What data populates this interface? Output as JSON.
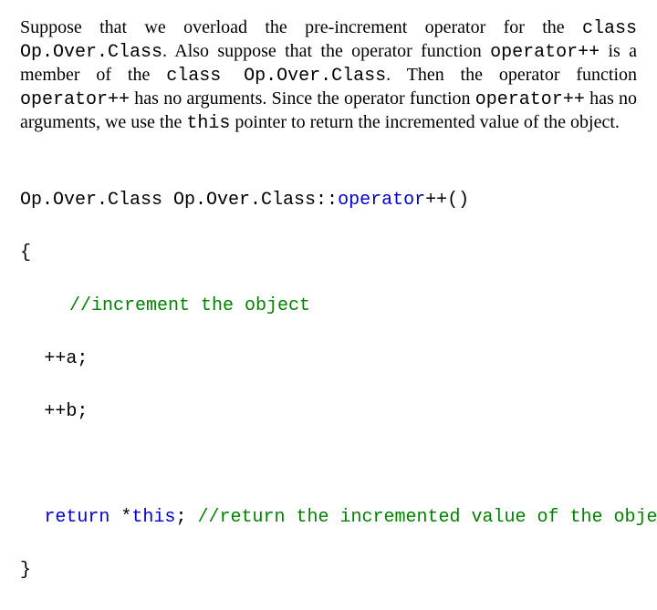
{
  "para": {
    "t1": "Suppose that we overload the pre-increment operator for the ",
    "c1": "class Op.Over.Class",
    "t2": ". Also suppose that the operator function ",
    "c2": "operator++",
    "t3": " is a member of the ",
    "c3": "class Op.Over.Class",
    "t4": ". Then the operator function ",
    "c4": "operator++",
    "t5": " has no arguments. Since the operator function ",
    "c5": "operator++",
    "t6": " has no arguments, we use the ",
    "c6": "this",
    "t7": " pointer to return the incremented value of the object."
  },
  "code": {
    "l1a": "Op.Over.Class Op.Over.Class::",
    "l1b": "operator",
    "l1c": "++()",
    "l2": "{",
    "l3": "//increment the object",
    "l4": "++a;",
    "l5": "++b;",
    "l6a": "return",
    "l6b": " *",
    "l6c": "this",
    "l6d": ";",
    "l6e": " //return the incremented value of the object",
    "l7": "}"
  }
}
